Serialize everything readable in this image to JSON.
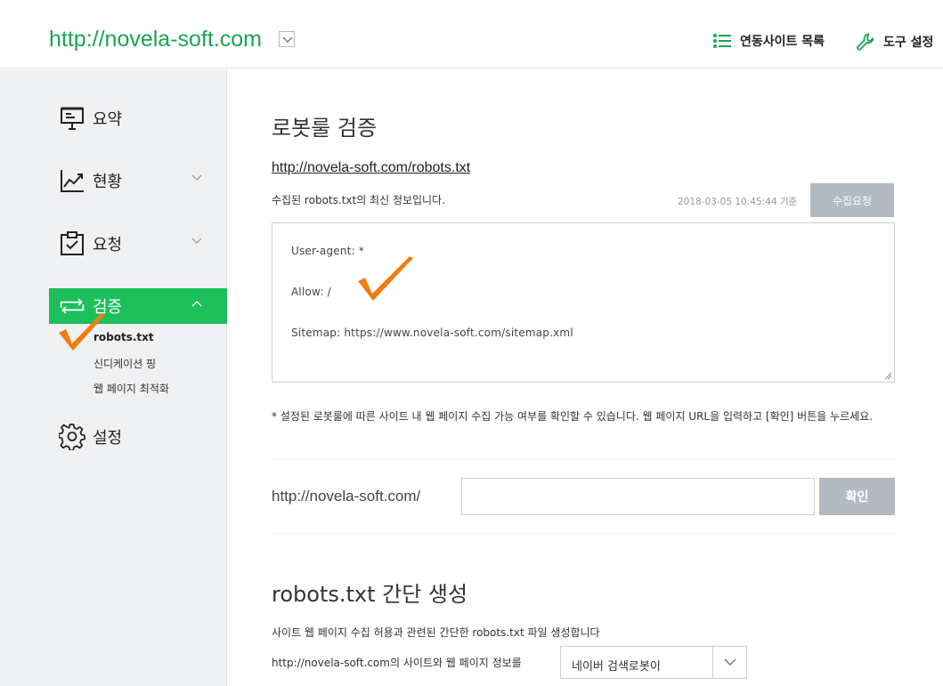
{
  "header": {
    "site_url": "http://novela-soft.com",
    "links": {
      "sites": "연동사이트 목록",
      "tools": "도구 설정"
    }
  },
  "sidebar": {
    "items": [
      {
        "label": "요약",
        "icon": "presentation-icon"
      },
      {
        "label": "현황",
        "icon": "chart-icon"
      },
      {
        "label": "요청",
        "icon": "clipboard-check-icon"
      },
      {
        "label": "검증",
        "icon": "sync-arrows-icon",
        "active": true
      },
      {
        "label": "설정",
        "icon": "gear-icon"
      }
    ],
    "subitems": [
      {
        "label": "robots.txt",
        "active": true
      },
      {
        "label": "신디케이션 핑"
      },
      {
        "label": "웹 페이지 최적화"
      }
    ]
  },
  "main": {
    "title": "로봇룰 검증",
    "robots_link": "http://novela-soft.com/robots.txt",
    "info_text": "수집된 robots.txt의 최신 정보입니다.",
    "timestamp": "2018-03-05 10:45:44 기준",
    "collect_button": "수집요청",
    "robots_lines": [
      "User-agent: *",
      "Allow: /",
      "Sitemap: https://www.novela-soft.com/sitemap.xml"
    ],
    "note": "* 설정된 로봇룰에 따른 사이트 내 웹 페이지 수집 가능 여부를 확인할 수 있습니다. 웹 페이지 URL을 입력하고 [확인] 버튼을 누르세요.",
    "url_prefix": "http://novela-soft.com/",
    "url_input_value": "",
    "confirm_button": "확인",
    "gen_title": "robots.txt 간단 생성",
    "gen_desc": "사이트 웹 페이지 수집 허용과 관련된 간단한 robots.txt 파일 생성합니다",
    "gen_label": "http://novela-soft.com의 사이트와 웹 페이지 정보를",
    "gen_select": "네이버 검색로봇이"
  },
  "colors": {
    "brand_green": "#1aa553",
    "active_green": "#1cbf5a",
    "button_gray": "#b4bac3",
    "annotation_orange": "#f07d12"
  }
}
